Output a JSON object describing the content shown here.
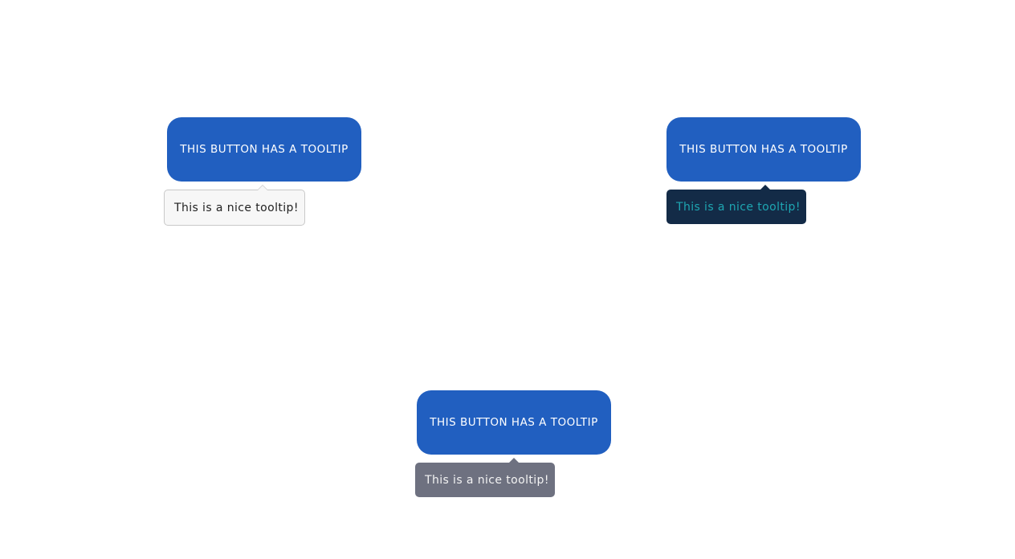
{
  "colors": {
    "button_bg": "#215fc0",
    "button_text": "#ffffff",
    "tooltip_light_bg": "#f7f7f7",
    "tooltip_light_border": "#c9c9c9",
    "tooltip_light_text": "#222222",
    "tooltip_dark_bg": "#132b47",
    "tooltip_dark_text": "#1ea6b2",
    "tooltip_gray_bg": "#6e7180",
    "tooltip_gray_text": "#f3f3f3"
  },
  "examples": [
    {
      "button_label": "THIS BUTTON HAS A TOOLTIP",
      "tooltip_text": "This is a nice tooltip!",
      "theme": "light"
    },
    {
      "button_label": "THIS BUTTON HAS A TOOLTIP",
      "tooltip_text": "This is a nice tooltip!",
      "theme": "dark"
    },
    {
      "button_label": "THIS BUTTON HAS A TOOLTIP",
      "tooltip_text": "This is a nice tooltip!",
      "theme": "gray"
    }
  ]
}
